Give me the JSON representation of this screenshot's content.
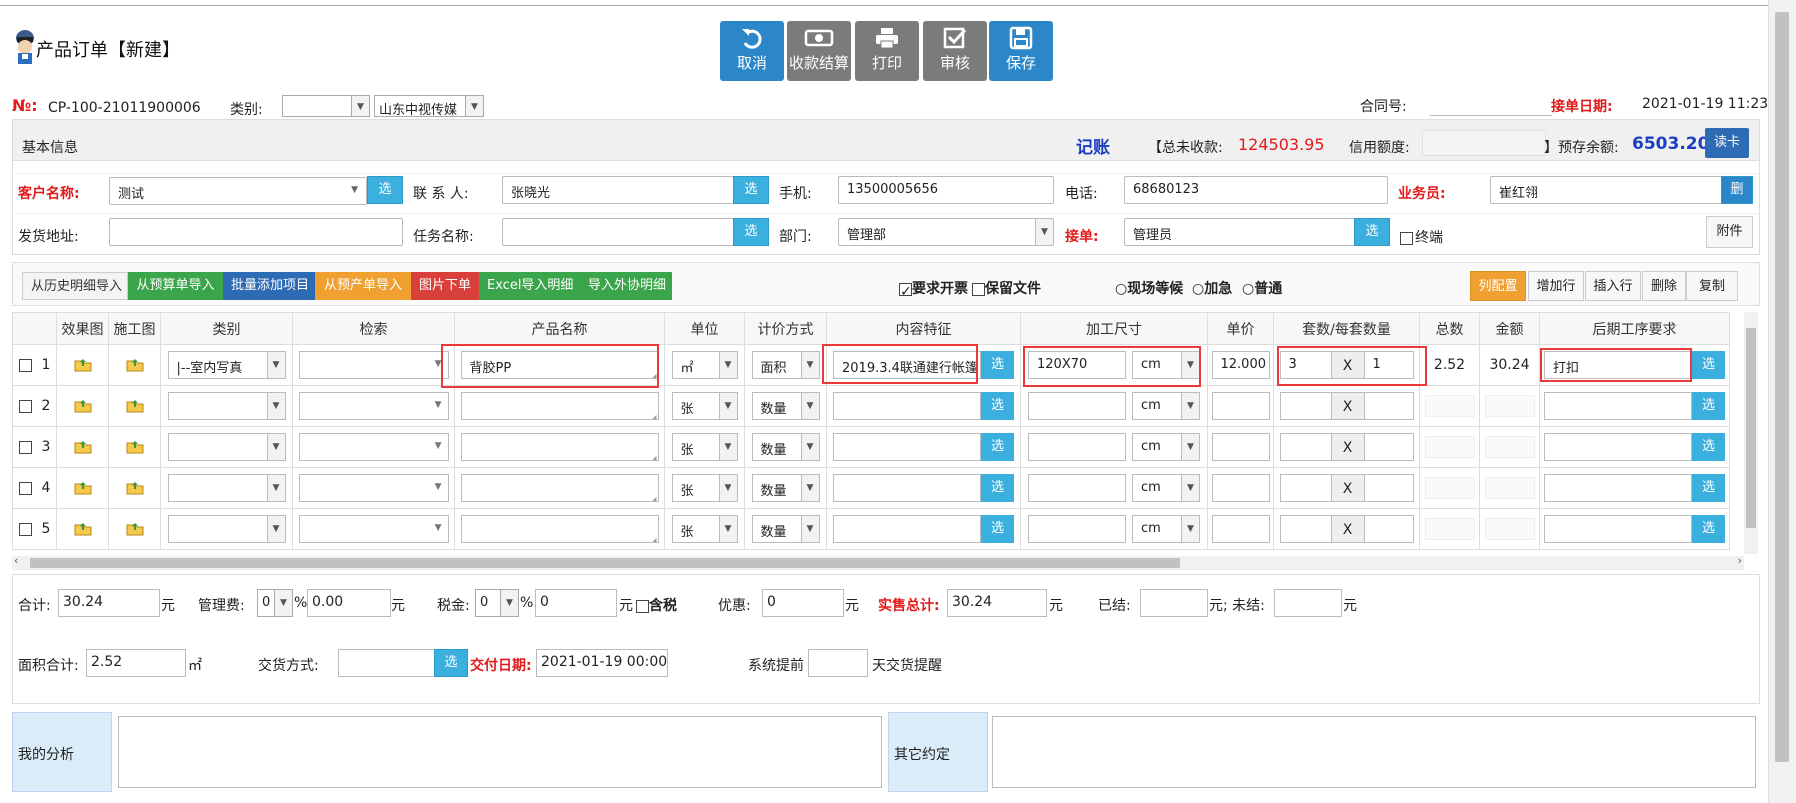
{
  "header": {
    "title": "产品订单【新建】",
    "toolbar": [
      {
        "label": "取消",
        "icon": "undo-icon",
        "color": "#2c87c9"
      },
      {
        "label": "收款结算",
        "icon": "money-icon",
        "color": "#7b7b7b"
      },
      {
        "label": "打印",
        "icon": "printer-icon",
        "color": "#7b7b7b"
      },
      {
        "label": "审核",
        "icon": "check-icon",
        "color": "#7b7b7b"
      },
      {
        "label": "保存",
        "icon": "save-icon",
        "color": "#2c87c9"
      }
    ]
  },
  "order": {
    "no_label": "№:",
    "no_value": "CP-100-21011900006",
    "category_label": "类别:",
    "category_value": "",
    "company_value": "山东中视传媒",
    "contract_label": "合同号:",
    "contract_value": "",
    "date_label": "接单日期:",
    "date_value": "2021-01-19 11:23"
  },
  "basic": {
    "section_label": "基本信息",
    "bookkeeping": "记账",
    "unpaid_label": "【总未收款:",
    "unpaid_value": "124503.95",
    "credit_label": "信用额度:",
    "credit_value": "",
    "deposit_label": "】预存余额:",
    "deposit_value": "6503.20",
    "readcard_label": "读卡",
    "customer_label": "客户名称:",
    "customer_value": "测试",
    "contact_label": "联 系 人:",
    "contact_value": "张晓光",
    "phone_label": "手机:",
    "phone_value": "13500005656",
    "tel_label": "电话:",
    "tel_value": "68680123",
    "sales_label": "业务员:",
    "sales_value": "崔红翎",
    "sales_btn": "删",
    "address_label": "发货地址:",
    "address_value": "",
    "task_label": "任务名称:",
    "task_value": "",
    "dept_label": "部门:",
    "dept_value": "管理部",
    "receiver_label": "接单:",
    "receiver_value": "管理员",
    "final_label": "终端",
    "attach_label": "附件",
    "select_btn": "选"
  },
  "actions": {
    "left": [
      {
        "label": "从历史明细导入",
        "color": "#f4f4f4",
        "text": "#333"
      },
      {
        "label": "从预算单导入",
        "color": "#3aa54a",
        "text": "#fff"
      },
      {
        "label": "批量添加项目",
        "color": "#2d6bb5",
        "text": "#fff"
      },
      {
        "label": "从预产单导入",
        "color": "#f0a030",
        "text": "#fff"
      },
      {
        "label": "图片下单",
        "color": "#d9403a",
        "text": "#fff"
      },
      {
        "label": "Excel导入明细",
        "color": "#3aa54a",
        "text": "#fff"
      },
      {
        "label": "导入外协明细",
        "color": "#3aa54a",
        "text": "#fff"
      }
    ],
    "need_invoice": "要求开票",
    "keep_file": "保留文件",
    "radio_wait": "现场等候",
    "radio_urgent": "加急",
    "radio_normal": "普通",
    "right": [
      "列配置",
      "增加行",
      "插入行",
      "删除",
      "复制"
    ]
  },
  "grid": {
    "headers": [
      "",
      "效果图",
      "施工图",
      "类别",
      "检索",
      "产品名称",
      "单位",
      "计价方式",
      "内容特征",
      "加工尺寸",
      "单价",
      "套数/每套数量",
      "总数",
      "金额",
      "后期工序要求"
    ],
    "x_symbol": "X",
    "select_btn": "选",
    "rows": [
      {
        "no": "1",
        "category": "|--室内写真",
        "search": "",
        "product": "背胶PP",
        "unit": "㎡",
        "pricing": "面积",
        "content": "2019.3.4联通建行帐篷",
        "size": "120X70",
        "size_unit": "cm",
        "price": "12.000",
        "sets": "3",
        "per_set": "1",
        "total": "2.52",
        "amount": "30.24",
        "post": "打扣"
      },
      {
        "no": "2",
        "category": "",
        "search": "",
        "product": "",
        "unit": "张",
        "pricing": "数量",
        "content": "",
        "size": "",
        "size_unit": "cm",
        "price": "",
        "sets": "",
        "per_set": "",
        "total": "",
        "amount": "",
        "post": ""
      },
      {
        "no": "3",
        "category": "",
        "search": "",
        "product": "",
        "unit": "张",
        "pricing": "数量",
        "content": "",
        "size": "",
        "size_unit": "cm",
        "price": "",
        "sets": "",
        "per_set": "",
        "total": "",
        "amount": "",
        "post": ""
      },
      {
        "no": "4",
        "category": "",
        "search": "",
        "product": "",
        "unit": "张",
        "pricing": "数量",
        "content": "",
        "size": "",
        "size_unit": "cm",
        "price": "",
        "sets": "",
        "per_set": "",
        "total": "",
        "amount": "",
        "post": ""
      },
      {
        "no": "5",
        "category": "",
        "search": "",
        "product": "",
        "unit": "张",
        "pricing": "数量",
        "content": "",
        "size": "",
        "size_unit": "cm",
        "price": "",
        "sets": "",
        "per_set": "",
        "total": "",
        "amount": "",
        "post": ""
      }
    ]
  },
  "totals": {
    "sum_label": "合计:",
    "sum_value": "30.24",
    "yuan": "元",
    "mgmt_label": "管理费:",
    "mgmt_pct": "0",
    "mgmt_value": "0.00",
    "pct": "%",
    "tax_label": "税金:",
    "tax_pct": "0",
    "tax_value": "0",
    "tax_incl": "含税",
    "discount_label": "优惠:",
    "discount_value": "0",
    "sale_total_label": "实售总计:",
    "sale_total_value": "30.24",
    "settled_label": "已结:",
    "settled_value": "",
    "unsettled_label": "元; 未结:",
    "unsettled_value": "",
    "area_label": "面积合计:",
    "area_value": "2.52",
    "area_unit": "㎡",
    "delivery_label": "交货方式:",
    "delivery_value": "",
    "due_label": "交付日期:",
    "due_value": "2021-01-19 00:00",
    "advance_label": "系统提前",
    "advance_value": "",
    "advance_suffix": "天交货提醒"
  },
  "notes": {
    "analysis_label": "我的分析",
    "analysis_value": "",
    "other_label": "其它约定",
    "other_value": ""
  }
}
